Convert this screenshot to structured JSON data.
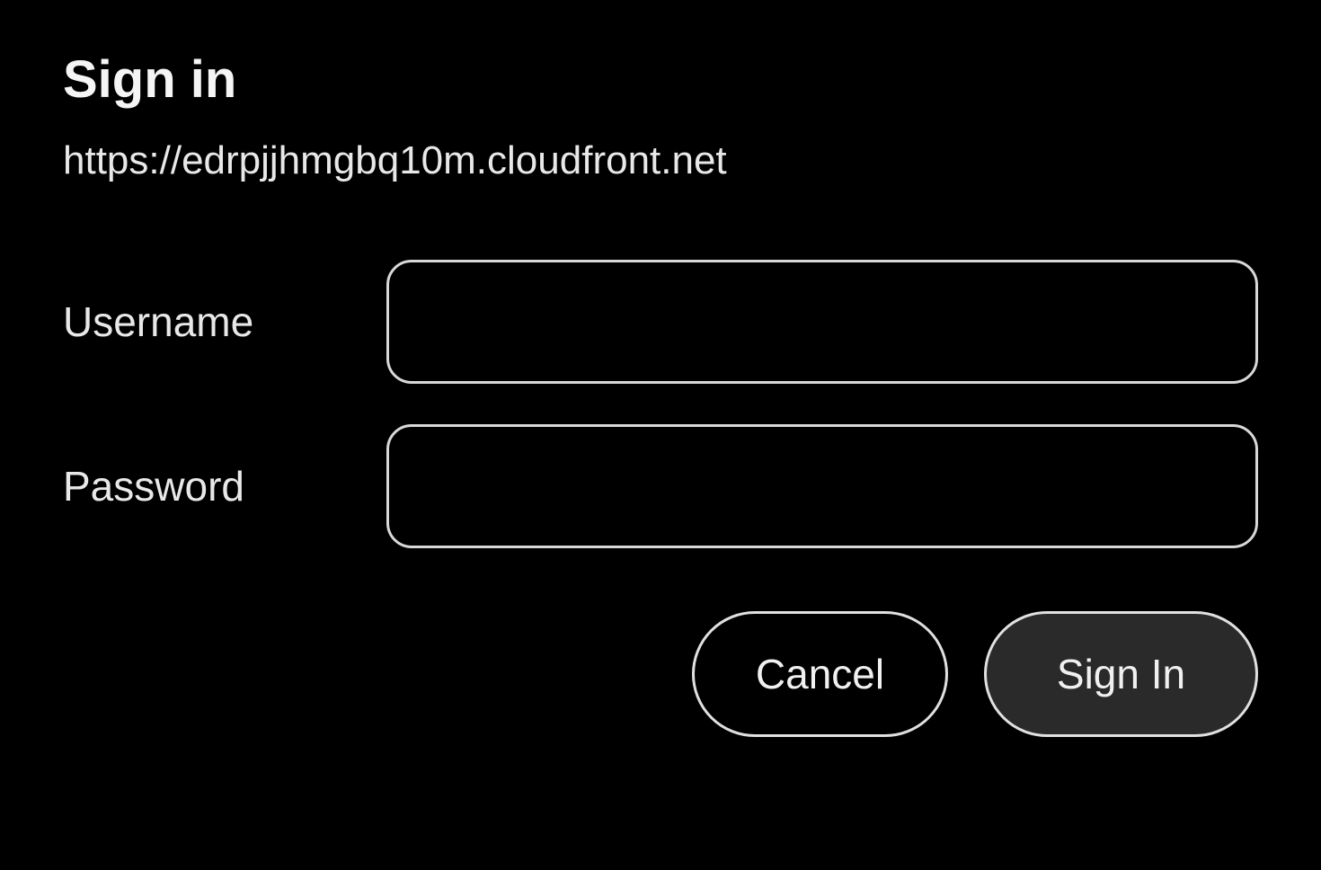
{
  "dialog": {
    "title": "Sign in",
    "url": "https://edrpjjhmgbq10m.cloudfront.net",
    "username_label": "Username",
    "username_value": "",
    "password_label": "Password",
    "password_value": "",
    "cancel_label": "Cancel",
    "signin_label": "Sign In"
  }
}
